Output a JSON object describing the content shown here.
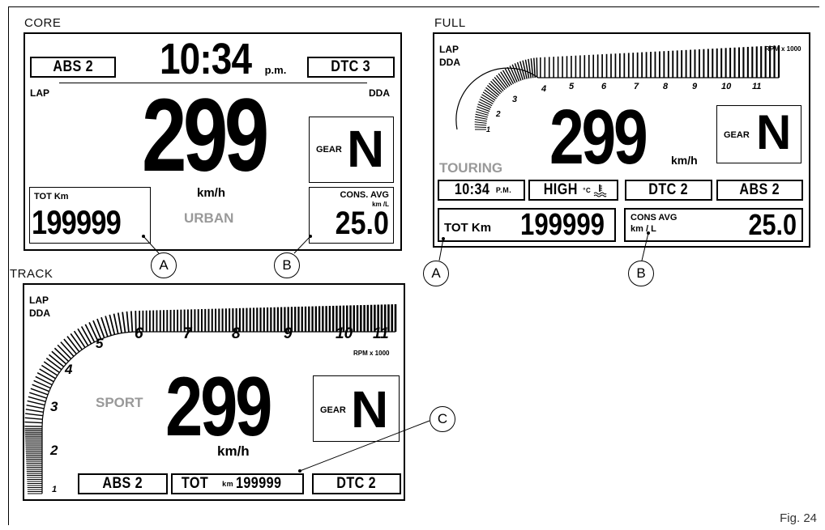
{
  "figure_label": "Fig. 24",
  "core": {
    "title": "CORE",
    "time": "10:34",
    "time_suffix": "p.m.",
    "abs": "ABS 2",
    "dtc": "DTC 3",
    "lap": "LAP",
    "dda": "DDA",
    "speed": "299",
    "speed_unit": "km/h",
    "gear_label": "GEAR",
    "gear_value": "N",
    "tot_label": "TOT Km",
    "tot_value": "199999",
    "mode": "URBAN",
    "cons_label": "CONS. AVG",
    "cons_unit": "km /L",
    "cons_value": "25.0",
    "callout_a": "A",
    "callout_b": "B"
  },
  "full": {
    "title": "FULL",
    "lap": "LAP",
    "dda": "DDA",
    "rpm_label": "RPM x 1000",
    "rpm_ticks": [
      "1",
      "2",
      "3",
      "4",
      "5",
      "6",
      "7",
      "8",
      "9",
      "10",
      "11"
    ],
    "speed": "299",
    "speed_unit": "km/h",
    "gear_label": "GEAR",
    "gear_value": "N",
    "mode": "TOURING",
    "time": "10:34",
    "time_suffix": "P.M.",
    "temp": "HIGH",
    "temp_unit": "°C",
    "dtc": "DTC 2",
    "abs": "ABS 2",
    "tot_label": "TOT Km",
    "tot_value": "199999",
    "cons_label": "CONS AVG",
    "cons_unit": "km / L",
    "cons_value": "25.0",
    "callout_a": "A",
    "callout_b": "B"
  },
  "track": {
    "title": "TRACK",
    "lap": "LAP",
    "dda": "DDA",
    "rpm_label": "RPM x 1000",
    "rpm_ticks": [
      "1",
      "2",
      "3",
      "4",
      "5",
      "6",
      "7",
      "8",
      "9",
      "10",
      "11"
    ],
    "mode": "SPORT",
    "speed": "299",
    "speed_unit": "km/h",
    "gear_label": "GEAR",
    "gear_value": "N",
    "abs": "ABS 2",
    "tot_label": "TOT",
    "tot_unit": "km",
    "tot_value": "199999",
    "dtc": "DTC 2",
    "callout_c": "C"
  }
}
